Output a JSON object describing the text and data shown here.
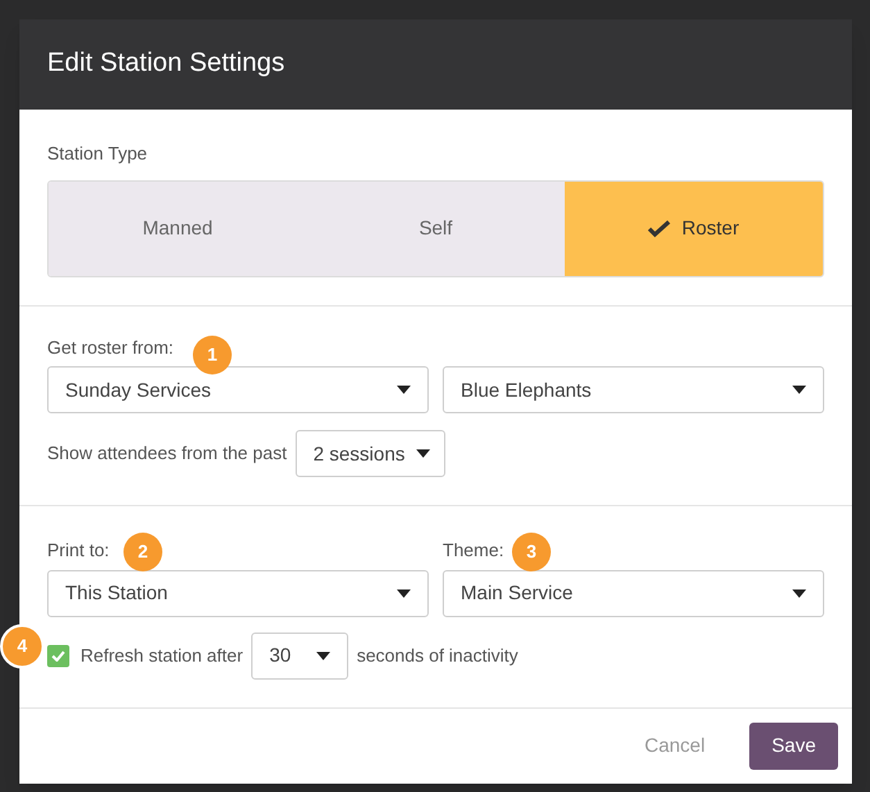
{
  "dialog": {
    "title": "Edit Station Settings"
  },
  "station_type": {
    "label": "Station Type",
    "options": [
      {
        "label": "Manned",
        "selected": false
      },
      {
        "label": "Self",
        "selected": false
      },
      {
        "label": "Roster",
        "selected": true
      }
    ]
  },
  "roster": {
    "label": "Get roster from:",
    "selects": [
      "Sunday Services",
      "Blue Elephants"
    ],
    "past_label": "Show attendees from the past",
    "past_value": "2 sessions"
  },
  "print": {
    "print_label": "Print to:",
    "print_value": "This Station",
    "theme_label": "Theme:",
    "theme_value": "Main Service",
    "refresh_checked": true,
    "refresh_label": "Refresh station after",
    "refresh_value": "30",
    "refresh_suffix": "seconds of inactivity"
  },
  "badges": [
    "1",
    "2",
    "3",
    "4"
  ],
  "buttons": {
    "cancel": "Cancel",
    "save": "Save"
  }
}
